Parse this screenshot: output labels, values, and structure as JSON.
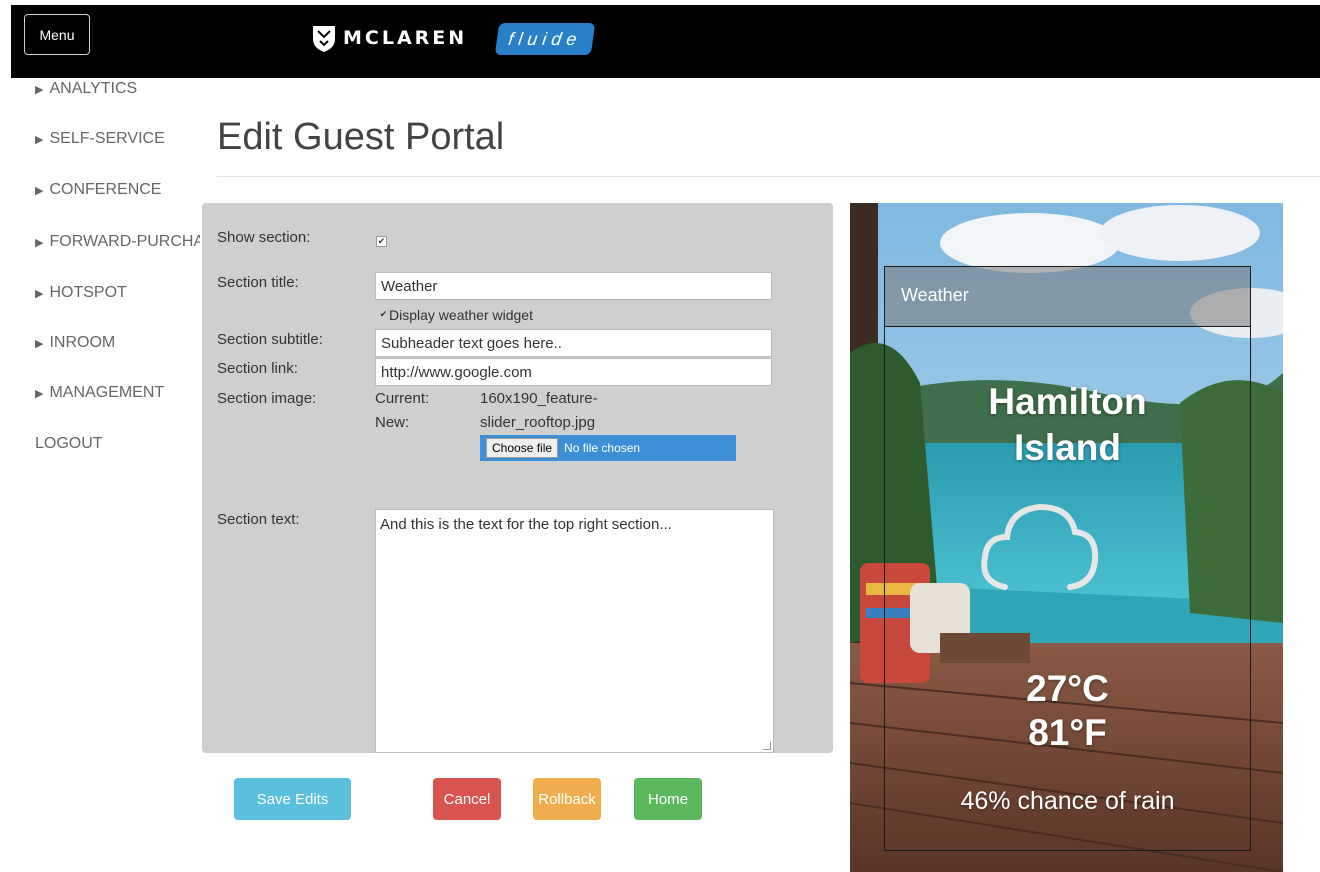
{
  "header": {
    "menu_label": "Menu",
    "brand_text": "MCLAREN",
    "product_text": "fluide"
  },
  "sidebar": {
    "items": [
      {
        "label": "ANALYTICS",
        "arrow": "▶"
      },
      {
        "label": "SELF-SERVICE",
        "arrow": "▶"
      },
      {
        "label": "CONFERENCE",
        "arrow": "▶"
      },
      {
        "label": "FORWARD-PURCHAS",
        "arrow": "▶"
      },
      {
        "label": "HOTSPOT",
        "arrow": "▶"
      },
      {
        "label": "INROOM",
        "arrow": "▶"
      },
      {
        "label": "MANAGEMENT",
        "arrow": "▶"
      },
      {
        "label": "LOGOUT",
        "arrow": ""
      }
    ]
  },
  "page": {
    "title": "Edit Guest Portal"
  },
  "form": {
    "show_section_label": "Show section:",
    "show_section_checked": true,
    "section_title_label": "Section title:",
    "section_title_value": "Weather",
    "display_weather_label": "Display weather widget",
    "display_weather_checked": true,
    "section_subtitle_label": "Section subtitle:",
    "section_subtitle_value": "Subheader text goes here..",
    "section_link_label": "Section link:",
    "section_link_value": "http://www.google.com",
    "section_image_label": "Section image:",
    "current_label": "Current:",
    "current_value_line1": "160x190_feature-",
    "current_value_line2": "slider_rooftop.jpg",
    "new_label": "New:",
    "choose_file_label": "Choose file",
    "no_file_label": "No file chosen",
    "section_text_label": "Section text:",
    "section_text_value": "And this is the text for the top right section..."
  },
  "actions": {
    "save": "Save Edits",
    "cancel": "Cancel",
    "rollback": "Rollback",
    "home": "Home"
  },
  "colors": {
    "save": "#5bc0de",
    "cancel": "#d9534f",
    "rollback": "#f0ad4e",
    "home": "#5cb85c",
    "fluide": "#2a7fc9"
  },
  "preview": {
    "header": "Weather",
    "city_line1": "Hamilton",
    "city_line2": "Island",
    "weather_icon": "cloud-icon",
    "temp_c": "27°C",
    "temp_f": "81°F",
    "rain": "46% chance of rain"
  }
}
